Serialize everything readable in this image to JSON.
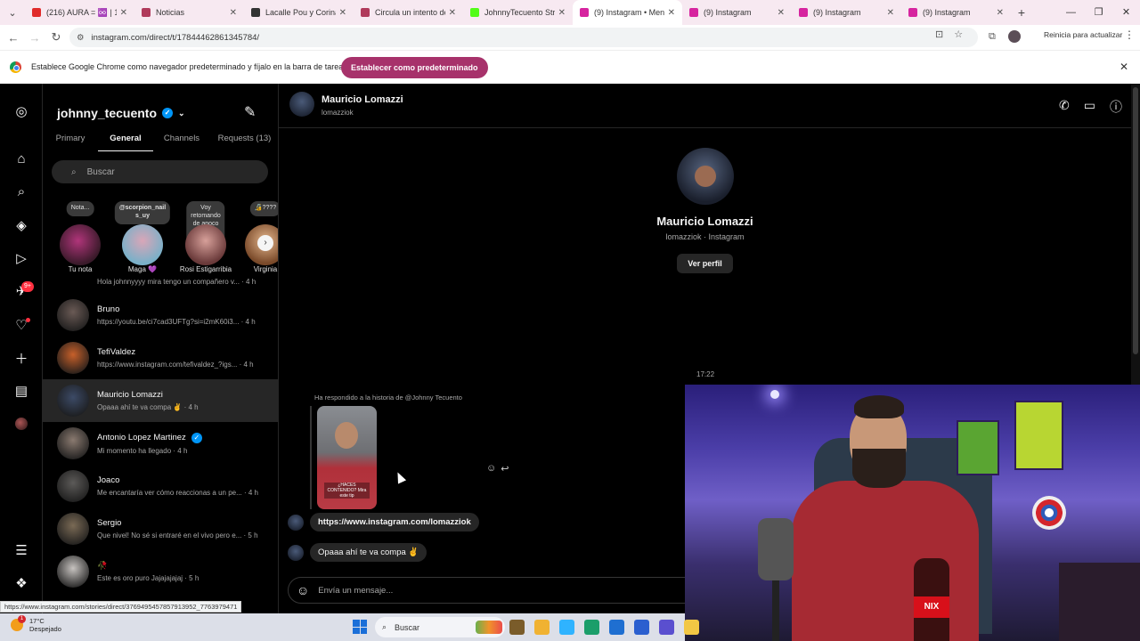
{
  "browser": {
    "tabs": [
      {
        "title": "(216) AURA = ♾️ | 1",
        "color": "#e02b2b",
        "active": false
      },
      {
        "title": "Noticias",
        "color": "#b03a5b",
        "active": false
      },
      {
        "title": "Lacalle Pou y Corina",
        "color": "#333333",
        "active": false
      },
      {
        "title": "Circula un intento de",
        "color": "#b03a5b",
        "active": false
      },
      {
        "title": "JohnnyTecuento Strea",
        "color": "#53fc18",
        "active": false
      },
      {
        "title": "(9) Instagram • Mens",
        "color": "#d6249f",
        "active": true
      },
      {
        "title": "(9) Instagram",
        "color": "#d6249f",
        "active": false
      },
      {
        "title": "(9) Instagram",
        "color": "#d6249f",
        "active": false
      },
      {
        "title": "(9) Instagram",
        "color": "#d6249f",
        "active": false
      }
    ],
    "new_tab": "+",
    "url": "instagram.com/direct/t/17844462861345784/",
    "update_label": "Reinicia para actualizar",
    "infobar_text": "Establece Google Chrome como navegador predeterminado y fíjalo en la barra de tareas",
    "infobar_button": "Establecer como predeterminado",
    "status_url": "https://www.instagram.com/stories/direct/3769495457857913952_7763979471"
  },
  "rail": {
    "badge": "9+"
  },
  "sidebar": {
    "account": "johnny_tecuento",
    "tabs": [
      "Primary",
      "General",
      "Channels",
      "Requests (13)"
    ],
    "active_tab": "General",
    "search_placeholder": "Buscar",
    "notes": [
      {
        "bubble": "Nota...",
        "name": "Tu nota"
      },
      {
        "bubble": "@scorpion_nail\ns_uy",
        "name": "Maga 💜"
      },
      {
        "bubble": "Voy retomando\nde apoco voy\nsubiendo todo...",
        "name": "Rosi Estigarribia"
      },
      {
        "bubble": "🔏????",
        "name": "Virginia"
      }
    ],
    "partial_preview": "Hola johnnyyyy mira tengo un compañero v... · 4 h",
    "chats": [
      {
        "name": "Bruno",
        "preview": "https://youtu.be/ci7cad3UFTg?si=i2mK60i3... · 4 h",
        "verified": false,
        "selected": false,
        "color": "#6a5a55"
      },
      {
        "name": "TefiValdez",
        "preview": "https://www.instagram.com/tefivaldez_?igs... · 4 h",
        "verified": false,
        "selected": false,
        "color": "#c7602a"
      },
      {
        "name": "Mauricio Lomazzi",
        "preview": "Opaaa ahí te va compa ✌️ · 4 h",
        "verified": false,
        "selected": true,
        "color": "#3c4a66"
      },
      {
        "name": "Antonio Lopez Martinez",
        "preview": "Mi momento ha llegado · 4 h",
        "verified": true,
        "selected": false,
        "color": "#8a7a70"
      },
      {
        "name": "Joaco",
        "preview": "Me encantaría ver cómo reaccionas a un pe... · 4 h",
        "verified": false,
        "selected": false,
        "color": "#5c5a58"
      },
      {
        "name": "Sergio",
        "preview": "Que nivel! No sé si entraré en el vivo pero e... · 5 h",
        "verified": false,
        "selected": false,
        "color": "#7a6a55"
      },
      {
        "name": "🥀",
        "preview": "Este es oro puro Jajajajajaj · 5 h",
        "verified": false,
        "selected": false,
        "color": "#c7c3c0"
      }
    ]
  },
  "conversation": {
    "name": "Mauricio Lomazzi",
    "username": "lomazziok",
    "profile_sub": "lomazziok · Instagram",
    "profile_button": "Ver perfil",
    "timestamp": "17:22",
    "reply_note": "Ha respondido a la historia de @Johnny Tecuento",
    "story_overlay": "¿HACES CONTENIDO? Mira este tip",
    "messages": [
      {
        "text": "https://www.instagram.com/lomazziok",
        "link": true
      },
      {
        "text": "Opaaa ahí te va compa ✌️",
        "link": false
      }
    ],
    "composer_placeholder": "Envía un mensaje..."
  },
  "webcam": {
    "bottle_label": "NIX"
  },
  "taskbar": {
    "weather_temp": "17°C",
    "weather_desc": "Despejado",
    "weather_badge": "1",
    "search_label": "Buscar",
    "apps": [
      "#7a5c2a",
      "#f0b232",
      "#2fb3ff",
      "#1b9e6a",
      "#1f6fd1",
      "#2b5fcf",
      "#5a4fcf",
      "#f2c744"
    ]
  },
  "colors": {
    "accent": "#a7326b",
    "instagram_bg": "#000000",
    "bubble": "#262626",
    "verified": "#0095f6"
  }
}
